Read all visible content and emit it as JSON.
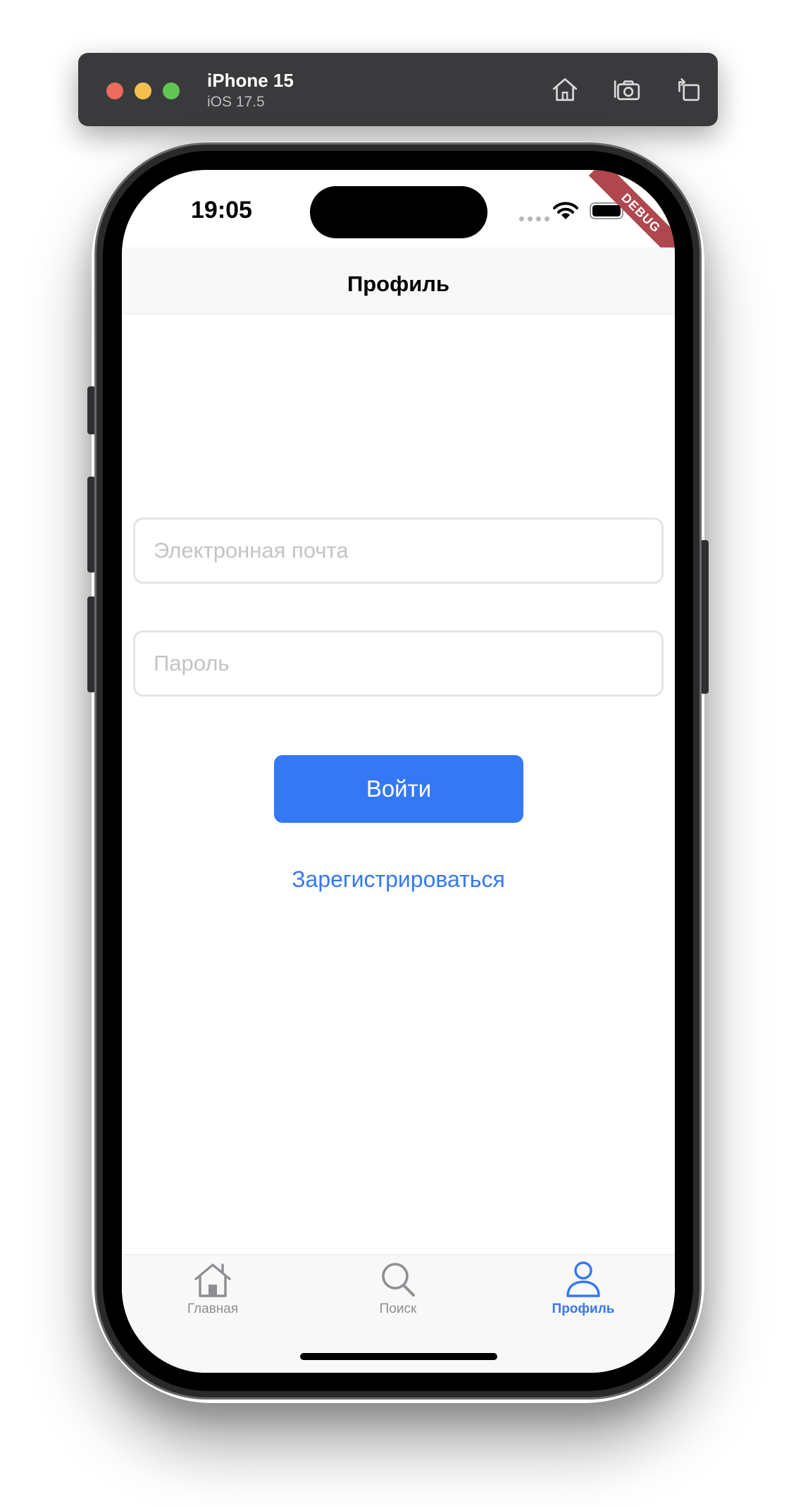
{
  "simulator": {
    "device_name": "iPhone 15",
    "os_version": "iOS 17.5",
    "toolbar_icons": [
      "home-icon",
      "camera-icon",
      "rotate-icon"
    ]
  },
  "status_bar": {
    "time": "19:05",
    "debug_banner": "DEBUG"
  },
  "nav_bar": {
    "title": "Профиль"
  },
  "login_form": {
    "email_placeholder": "Электронная почта",
    "email_value": "",
    "password_placeholder": "Пароль",
    "password_value": "",
    "login_button": "Войти",
    "register_link": "Зарегистрироваться"
  },
  "tab_bar": {
    "tabs": [
      {
        "label": "Главная",
        "icon": "home-icon",
        "active": false
      },
      {
        "label": "Поиск",
        "icon": "search-icon",
        "active": false
      },
      {
        "label": "Профиль",
        "icon": "person-icon",
        "active": true
      }
    ]
  },
  "colors": {
    "accent": "#3478f6",
    "inactive_tab": "#8e8e93",
    "debug_ribbon": "#b0474f"
  }
}
